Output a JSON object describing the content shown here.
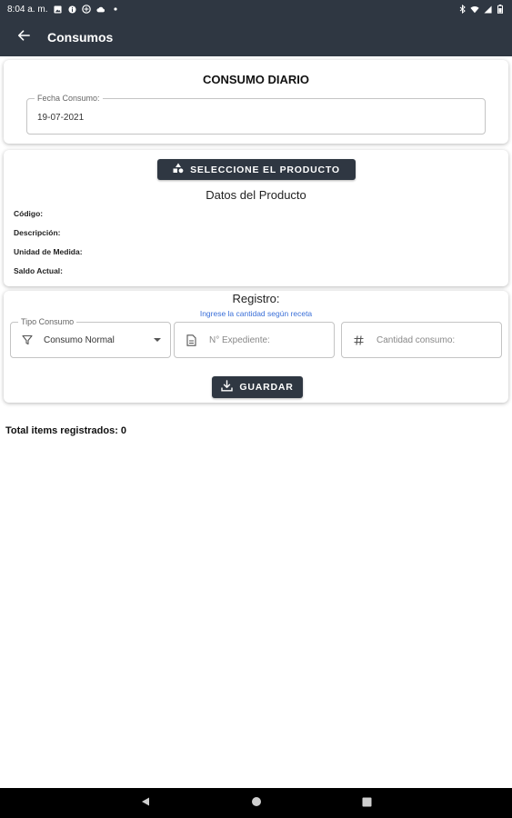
{
  "status_bar": {
    "time": "8:04 a. m.",
    "icons_left": [
      "image-icon",
      "info-icon",
      "vpn-icon",
      "cloud-icon",
      "dot-icon"
    ],
    "icons_right": [
      "bluetooth-icon",
      "wifi-icon",
      "signal-icon",
      "battery-icon"
    ]
  },
  "app_bar": {
    "title": "Consumos",
    "back_icon": "arrow-back-icon"
  },
  "daily": {
    "title": "CONSUMO DIARIO",
    "date_label": "Fecha Consumo:",
    "date_value": "19-07-2021"
  },
  "product": {
    "select_button": "SELECCIONE EL PRODUCTO",
    "select_icon": "shapes-icon",
    "title": "Datos del Producto",
    "labels": [
      "Código:",
      "Descripción:",
      "Unidad de Medida:",
      "Saldo Actual:"
    ]
  },
  "registro": {
    "title": "Registro:",
    "hint": "Ingrese la cantidad según receta",
    "tipo_label": "Tipo Consumo",
    "tipo_value": "Consumo Normal",
    "tipo_icon": "filter-icon",
    "expediente_placeholder": "N° Expediente:",
    "expediente_icon": "document-icon",
    "cantidad_placeholder": "Cantidad consumo:",
    "cantidad_icon": "hash-icon",
    "save_button": "GUARDAR",
    "save_icon": "download-icon"
  },
  "total": {
    "label": "Total items registrados: 0"
  },
  "nav": {
    "buttons": [
      "back-triangle-icon",
      "home-circle-icon",
      "recents-square-icon"
    ]
  },
  "colors": {
    "primary_dark": "#2f3742",
    "link_blue": "#3a6fd8"
  }
}
